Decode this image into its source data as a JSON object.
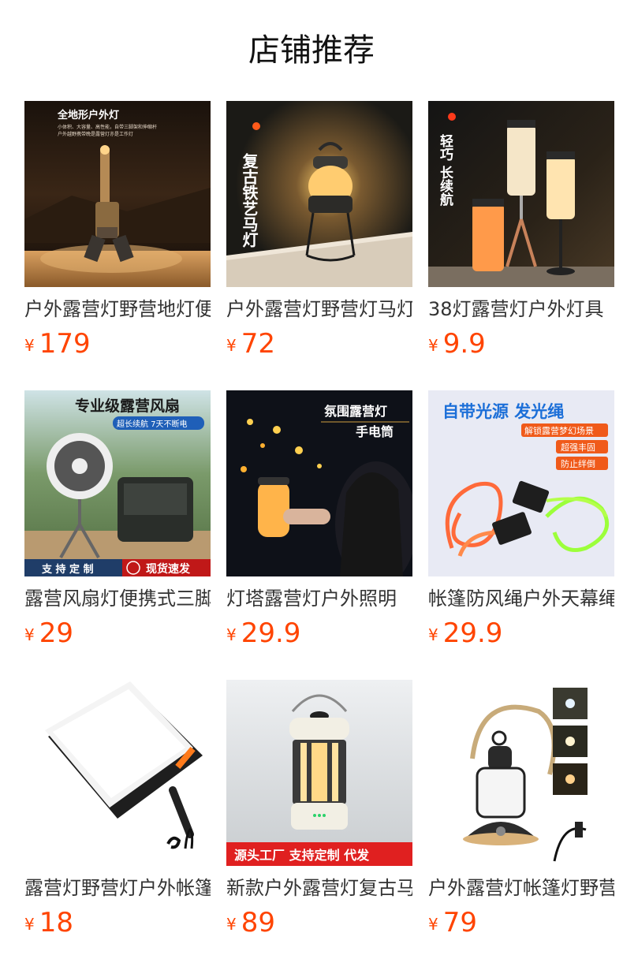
{
  "page_title": "店铺推荐",
  "currency": "¥",
  "products": [
    {
      "name": "户外露营灯野营地灯便携式",
      "price": "179",
      "img_text": [
        "全地形户外灯",
        "小体积、大容量、高性能，自带三脚架和伸缩杆",
        "户外越野携带晚是露营灯亦是工作灯"
      ]
    },
    {
      "name": "户外露营灯野营灯马灯复古",
      "price": "72",
      "img_text": [
        "复古铁艺马灯"
      ]
    },
    {
      "name": "38灯露营灯户外灯具",
      "price": "9.9",
      "img_text": [
        "轻巧 长续航"
      ]
    },
    {
      "name": "露营风扇灯便携式三脚架",
      "price": "29",
      "img_text": [
        "专业级露营风扇",
        "超长续航 7天不断电",
        "支 持 定 制",
        "现货速发"
      ]
    },
    {
      "name": "灯塔露营灯户外照明",
      "price": "29.9",
      "img_text": [
        "氛围露营灯",
        "手电筒"
      ]
    },
    {
      "name": "帐篷防风绳户外天幕绳",
      "price": "29.9",
      "img_text": [
        "自带光源 发光绳",
        "解锁露营梦幻场景",
        "超强丰固",
        "防止绊倒"
      ]
    },
    {
      "name": "露营灯野营灯户外帐篷灯",
      "price": "18",
      "img_text": []
    },
    {
      "name": "新款户外露营灯复古马灯",
      "price": "89",
      "img_text": [
        "源头工厂 支持定制 代发"
      ]
    },
    {
      "name": "户外露营灯帐篷灯野营灯",
      "price": "79",
      "img_text": []
    }
  ],
  "colors": {
    "price": "#ff4400",
    "title": "#111111"
  }
}
